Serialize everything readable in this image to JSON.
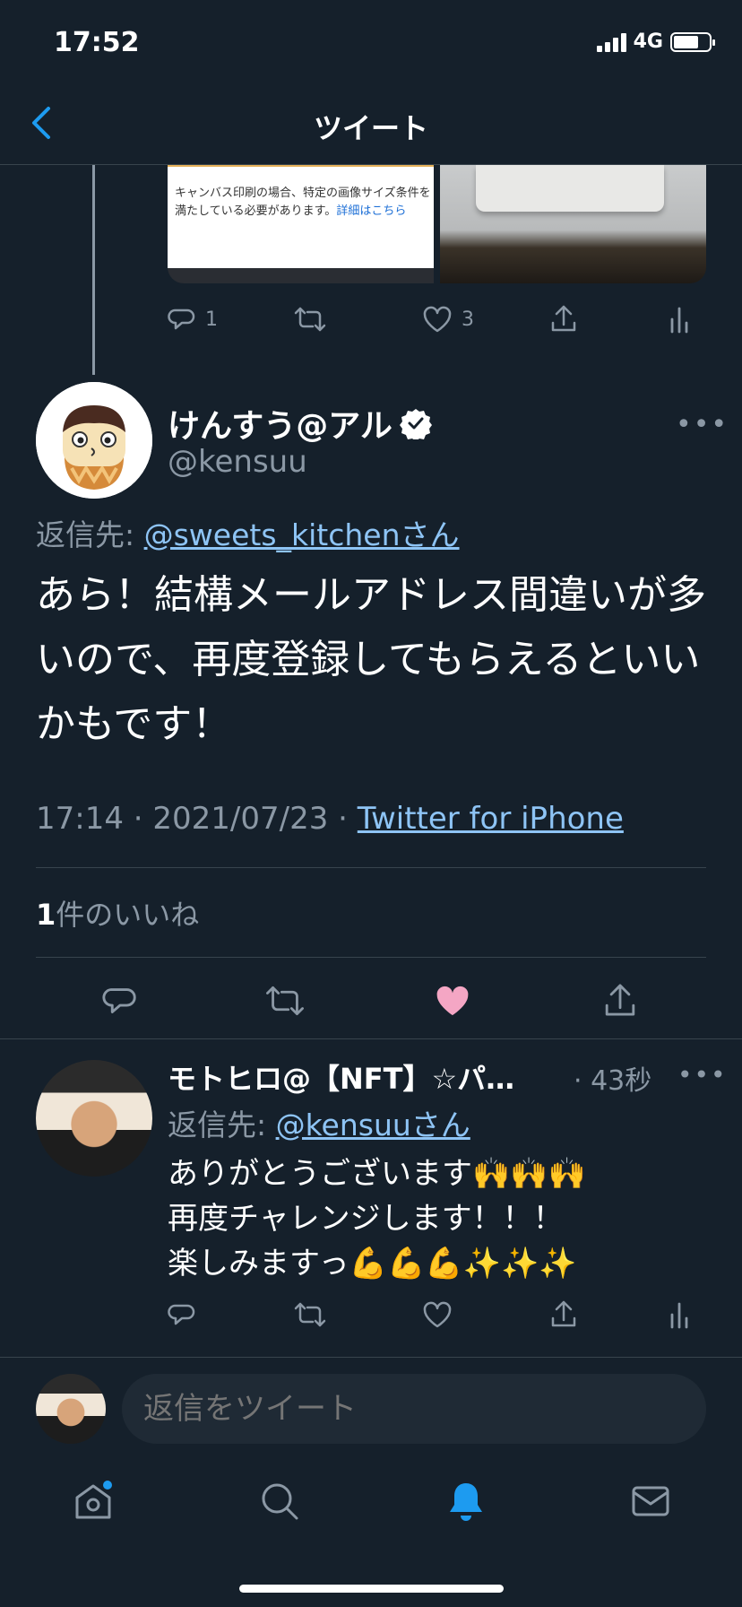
{
  "status_bar": {
    "time": "17:52",
    "network": "4G"
  },
  "header": {
    "title": "ツイート"
  },
  "prev_tweet": {
    "image_caption": "キャンバス印刷の場合、特定の画像サイズ条件を満たしている必要があります。",
    "image_caption_link": "詳細はこちら",
    "reply_count": "1",
    "like_count": "3"
  },
  "main_tweet": {
    "display_name": "けんすう@アル",
    "handle": "@kensuu",
    "reply_to_label": "返信先: ",
    "reply_to_user": "@sweets_kitchenさん",
    "text": "あら！結構メールアドレス間違いが多いので、再度登録してもらえるといいかもです！",
    "timestamp": "17:14 · 2021/07/23 · ",
    "source": "Twitter for iPhone",
    "likes_count": "1",
    "likes_label": "件のいいね",
    "liked": true
  },
  "reply": {
    "display_name": "モトヒロ@【NFT】☆パ…",
    "time": "· 43秒",
    "reply_to_label": "返信先: ",
    "reply_to_user": "@kensuuさん",
    "line1": "ありがとうございます🙌🙌🙌",
    "line2": "再度チャレンジします！！！",
    "line3": "楽しみますっ💪💪💪✨✨✨"
  },
  "composer": {
    "placeholder": "返信をツイート"
  },
  "tab_bar": {
    "items": [
      "home",
      "search",
      "notifications",
      "messages"
    ],
    "active": "notifications",
    "home_has_badge": true
  },
  "colors": {
    "background": "#15202b",
    "accent": "#1d9bf0",
    "like": "#f4a6c4",
    "muted": "#8b98a5"
  }
}
